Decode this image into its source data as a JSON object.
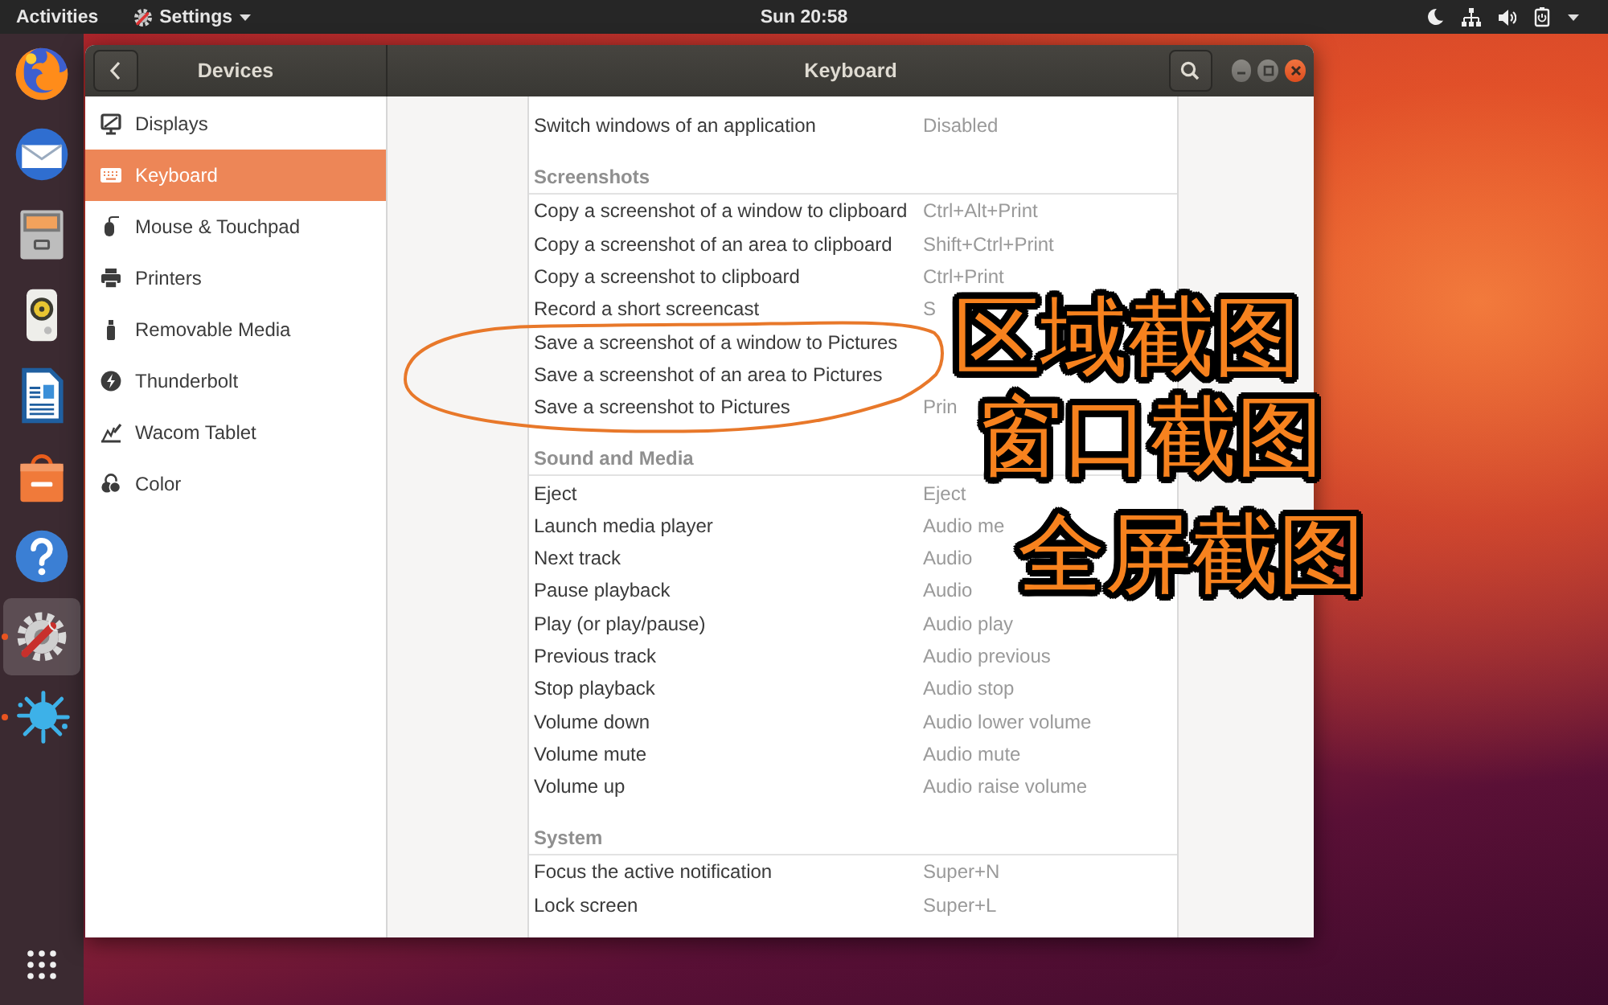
{
  "top_bar": {
    "activities": "Activities",
    "app_menu": "Settings",
    "clock": "Sun 20:58"
  },
  "dock": {
    "items": [
      {
        "kind": "browser",
        "running": false,
        "selected": false
      },
      {
        "kind": "mail",
        "running": false,
        "selected": false
      },
      {
        "kind": "files",
        "running": false,
        "selected": false
      },
      {
        "kind": "music",
        "running": false,
        "selected": false
      },
      {
        "kind": "writer",
        "running": false,
        "selected": false
      },
      {
        "kind": "store",
        "running": false,
        "selected": false
      },
      {
        "kind": "help",
        "running": false,
        "selected": false
      },
      {
        "kind": "settings",
        "running": true,
        "selected": true
      },
      {
        "kind": "splash",
        "running": true,
        "selected": false
      }
    ]
  },
  "window": {
    "sidebar_title": "Devices",
    "title": "Keyboard"
  },
  "sidebar": {
    "items": [
      {
        "kind": "displays",
        "label": "Displays",
        "selected": false
      },
      {
        "kind": "keyboard",
        "label": "Keyboard",
        "selected": true
      },
      {
        "kind": "mouse",
        "label": "Mouse & Touchpad",
        "selected": false
      },
      {
        "kind": "printers",
        "label": "Printers",
        "selected": false
      },
      {
        "kind": "removable",
        "label": "Removable Media",
        "selected": false
      },
      {
        "kind": "thunderbolt",
        "label": "Thunderbolt",
        "selected": false
      },
      {
        "kind": "wacom",
        "label": "Wacom Tablet",
        "selected": false
      },
      {
        "kind": "color",
        "label": "Color",
        "selected": false
      }
    ]
  },
  "shortcuts": {
    "sections": [
      {
        "rows": [
          {
            "action": "Switch windows of an application",
            "keys": "Disabled"
          }
        ]
      },
      {
        "title": "Screenshots",
        "rows": [
          {
            "action": "Copy a screenshot of a window to clipboard",
            "keys": "Ctrl+Alt+Print"
          },
          {
            "action": "Copy a screenshot of an area to clipboard",
            "keys": "Shift+Ctrl+Print"
          },
          {
            "action": "Copy a screenshot to clipboard",
            "keys": "Ctrl+Print"
          },
          {
            "action": "Record a short screencast",
            "keys": "S"
          },
          {
            "action": "Save a screenshot of a window to Pictures"
          },
          {
            "action": "Save a screenshot of an area to Pictures"
          },
          {
            "action": "Save a screenshot to Pictures",
            "keys": "Prin"
          }
        ]
      },
      {
        "title": "Sound and Media",
        "rows": [
          {
            "action": "Eject",
            "keys": "Eject"
          },
          {
            "action": "Launch media player",
            "keys": "Audio me"
          },
          {
            "action": "Next track",
            "keys": "Audio"
          },
          {
            "action": "Pause playback",
            "keys": "Audio"
          },
          {
            "action": "Play (or play/pause)",
            "keys": "Audio play"
          },
          {
            "action": "Previous track",
            "keys": "Audio previous"
          },
          {
            "action": "Stop playback",
            "keys": "Audio stop"
          },
          {
            "action": "Volume down",
            "keys": "Audio lower volume"
          },
          {
            "action": "Volume mute",
            "keys": "Audio mute"
          },
          {
            "action": "Volume up",
            "keys": "Audio raise volume"
          }
        ]
      },
      {
        "title": "System",
        "rows": [
          {
            "action": "Focus the active notification",
            "keys": "Super+N"
          },
          {
            "action": "Lock screen",
            "keys": "Super+L"
          }
        ]
      }
    ]
  },
  "annotation": {
    "captions": [
      "区域截图",
      "窗口截图",
      "全屏截图"
    ]
  }
}
